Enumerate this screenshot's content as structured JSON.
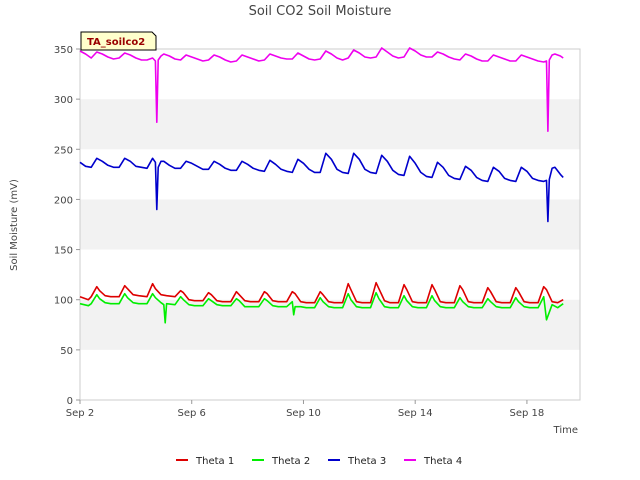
{
  "chart_data": {
    "type": "line",
    "title": "Soil CO2 Soil Moisture",
    "xlabel": "Time",
    "ylabel": "Soil Moisture (mV)",
    "annotation": "TA_soilco2",
    "ylim": [
      0,
      350
    ],
    "xlim_days": [
      2.0,
      19.9
    ],
    "ytick_values": [
      0,
      50,
      100,
      150,
      200,
      250,
      300,
      350
    ],
    "ytick_labels": [
      "0",
      "50",
      "100",
      "150",
      "200",
      "250",
      "300",
      "350"
    ],
    "xtick_values": [
      2,
      6,
      10,
      14,
      18
    ],
    "xtick_labels": [
      "Sep 2",
      "Sep 6",
      "Sep 10",
      "Sep 14",
      "Sep 18"
    ],
    "grid": "horizontal bands",
    "legend_position": "bottom-center",
    "series": [
      {
        "name": "Theta 1",
        "color": "#dd0000",
        "x": [
          2.0,
          2.3,
          2.4,
          2.6,
          2.7,
          2.9,
          3.1,
          3.4,
          3.6,
          3.7,
          3.9,
          4.1,
          4.4,
          4.6,
          4.7,
          4.9,
          5.1,
          5.4,
          5.6,
          5.7,
          5.9,
          6.1,
          6.4,
          6.6,
          6.7,
          6.9,
          7.1,
          7.4,
          7.6,
          7.7,
          7.9,
          8.1,
          8.4,
          8.6,
          8.7,
          8.9,
          9.1,
          9.4,
          9.6,
          9.7,
          9.9,
          10.1,
          10.4,
          10.6,
          10.7,
          10.9,
          11.1,
          11.4,
          11.6,
          11.7,
          11.9,
          12.1,
          12.4,
          12.6,
          12.7,
          12.9,
          13.1,
          13.4,
          13.6,
          13.7,
          13.9,
          14.1,
          14.4,
          14.6,
          14.7,
          14.9,
          15.1,
          15.4,
          15.6,
          15.7,
          15.9,
          16.1,
          16.4,
          16.6,
          16.7,
          16.9,
          17.1,
          17.4,
          17.6,
          17.7,
          17.9,
          18.1,
          18.4,
          18.6,
          18.7,
          18.9,
          19.1,
          19.3
        ],
        "values": [
          103,
          100,
          103,
          113,
          109,
          104,
          103,
          103,
          114,
          111,
          105,
          104,
          103,
          116,
          111,
          105,
          104,
          103,
          109,
          107,
          100,
          99,
          99,
          107,
          105,
          99,
          98,
          98,
          108,
          105,
          99,
          98,
          98,
          108,
          106,
          99,
          98,
          98,
          108,
          106,
          98,
          97,
          97,
          108,
          105,
          98,
          97,
          97,
          116,
          110,
          98,
          97,
          97,
          117,
          111,
          99,
          97,
          97,
          115,
          110,
          98,
          97,
          97,
          115,
          110,
          98,
          97,
          97,
          114,
          110,
          98,
          97,
          97,
          112,
          108,
          98,
          97,
          97,
          112,
          108,
          98,
          97,
          97,
          113,
          110,
          98,
          97,
          100
        ]
      },
      {
        "name": "Theta 2",
        "color": "#00ee00",
        "x": [
          2.0,
          2.3,
          2.4,
          2.6,
          2.7,
          2.9,
          3.1,
          3.4,
          3.6,
          3.7,
          3.9,
          4.1,
          4.4,
          4.6,
          4.7,
          4.9,
          5.0,
          5.05,
          5.1,
          5.4,
          5.6,
          5.7,
          5.9,
          6.1,
          6.4,
          6.6,
          6.7,
          6.9,
          7.1,
          7.4,
          7.6,
          7.7,
          7.9,
          8.1,
          8.4,
          8.6,
          8.7,
          8.9,
          9.1,
          9.4,
          9.6,
          9.65,
          9.7,
          9.9,
          10.1,
          10.4,
          10.6,
          10.7,
          10.9,
          11.1,
          11.4,
          11.6,
          11.7,
          11.9,
          12.1,
          12.4,
          12.6,
          12.7,
          12.9,
          13.1,
          13.4,
          13.6,
          13.7,
          13.9,
          14.1,
          14.4,
          14.6,
          14.7,
          14.9,
          15.1,
          15.4,
          15.6,
          15.7,
          15.9,
          16.1,
          16.4,
          16.6,
          16.7,
          16.9,
          17.1,
          17.4,
          17.6,
          17.7,
          17.9,
          18.1,
          18.4,
          18.6,
          18.7,
          18.9,
          19.1,
          19.3
        ],
        "values": [
          96,
          94,
          96,
          105,
          101,
          97,
          96,
          96,
          106,
          102,
          97,
          96,
          96,
          106,
          102,
          97,
          95,
          77,
          96,
          95,
          103,
          100,
          95,
          94,
          94,
          101,
          99,
          95,
          94,
          94,
          101,
          99,
          93,
          93,
          93,
          101,
          99,
          94,
          93,
          93,
          98,
          85,
          93,
          93,
          92,
          92,
          102,
          98,
          93,
          92,
          92,
          106,
          100,
          93,
          92,
          92,
          107,
          101,
          93,
          92,
          92,
          104,
          99,
          93,
          92,
          92,
          104,
          99,
          93,
          92,
          92,
          102,
          98,
          93,
          92,
          92,
          101,
          98,
          93,
          92,
          92,
          102,
          98,
          93,
          92,
          92,
          103,
          80,
          95,
          92,
          96
        ]
      },
      {
        "name": "Theta 3",
        "color": "#0000cc",
        "x": [
          2.0,
          2.2,
          2.4,
          2.6,
          2.8,
          3.0,
          3.2,
          3.4,
          3.6,
          3.8,
          4.0,
          4.2,
          4.4,
          4.6,
          4.7,
          4.75,
          4.8,
          4.9,
          5.0,
          5.2,
          5.4,
          5.6,
          5.8,
          6.0,
          6.2,
          6.4,
          6.6,
          6.8,
          7.0,
          7.2,
          7.4,
          7.6,
          7.8,
          8.0,
          8.2,
          8.4,
          8.6,
          8.8,
          9.0,
          9.2,
          9.4,
          9.6,
          9.8,
          10.0,
          10.2,
          10.4,
          10.6,
          10.8,
          11.0,
          11.2,
          11.4,
          11.6,
          11.8,
          12.0,
          12.2,
          12.4,
          12.6,
          12.8,
          13.0,
          13.2,
          13.4,
          13.6,
          13.8,
          14.0,
          14.2,
          14.4,
          14.6,
          14.8,
          15.0,
          15.2,
          15.4,
          15.6,
          15.8,
          16.0,
          16.2,
          16.4,
          16.6,
          16.8,
          17.0,
          17.2,
          17.4,
          17.6,
          17.8,
          18.0,
          18.2,
          18.4,
          18.6,
          18.7,
          18.75,
          18.8,
          18.9,
          19.0,
          19.2,
          19.3
        ],
        "values": [
          237,
          233,
          232,
          241,
          238,
          234,
          232,
          232,
          241,
          238,
          233,
          232,
          231,
          241,
          237,
          190,
          232,
          238,
          238,
          234,
          231,
          231,
          238,
          236,
          233,
          230,
          230,
          238,
          235,
          231,
          229,
          229,
          238,
          235,
          231,
          229,
          228,
          239,
          235,
          230,
          228,
          227,
          240,
          236,
          230,
          227,
          227,
          246,
          240,
          230,
          227,
          226,
          246,
          240,
          230,
          227,
          226,
          244,
          238,
          229,
          225,
          224,
          243,
          236,
          227,
          223,
          222,
          237,
          232,
          224,
          221,
          220,
          233,
          229,
          222,
          219,
          218,
          232,
          228,
          221,
          219,
          218,
          232,
          228,
          221,
          219,
          218,
          219,
          178,
          220,
          231,
          232,
          225,
          222
        ]
      },
      {
        "name": "Theta 4",
        "color": "#ee00ee",
        "x": [
          2.0,
          2.2,
          2.4,
          2.6,
          2.8,
          3.0,
          3.2,
          3.4,
          3.6,
          3.8,
          4.0,
          4.2,
          4.4,
          4.6,
          4.7,
          4.75,
          4.8,
          4.9,
          5.0,
          5.2,
          5.4,
          5.6,
          5.8,
          6.0,
          6.2,
          6.4,
          6.6,
          6.8,
          7.0,
          7.2,
          7.4,
          7.6,
          7.8,
          8.0,
          8.2,
          8.4,
          8.6,
          8.8,
          9.0,
          9.2,
          9.4,
          9.6,
          9.8,
          10.0,
          10.2,
          10.4,
          10.6,
          10.8,
          11.0,
          11.2,
          11.4,
          11.6,
          11.8,
          12.0,
          12.2,
          12.4,
          12.6,
          12.8,
          13.0,
          13.2,
          13.4,
          13.6,
          13.8,
          14.0,
          14.2,
          14.4,
          14.6,
          14.8,
          15.0,
          15.2,
          15.4,
          15.6,
          15.8,
          16.0,
          16.2,
          16.4,
          16.6,
          16.8,
          17.0,
          17.2,
          17.4,
          17.6,
          17.8,
          18.0,
          18.2,
          18.4,
          18.6,
          18.7,
          18.75,
          18.8,
          18.9,
          19.0,
          19.2,
          19.3
        ],
        "values": [
          348,
          345,
          341,
          347,
          345,
          342,
          340,
          341,
          346,
          344,
          341,
          339,
          339,
          341,
          338,
          277,
          339,
          343,
          345,
          343,
          340,
          339,
          344,
          342,
          340,
          338,
          339,
          344,
          342,
          339,
          337,
          338,
          344,
          342,
          340,
          338,
          339,
          345,
          343,
          341,
          340,
          340,
          346,
          343,
          340,
          339,
          340,
          348,
          345,
          341,
          339,
          341,
          349,
          346,
          342,
          341,
          342,
          351,
          347,
          343,
          341,
          342,
          351,
          348,
          344,
          342,
          342,
          347,
          345,
          342,
          340,
          339,
          345,
          343,
          340,
          338,
          338,
          344,
          342,
          340,
          338,
          338,
          344,
          342,
          340,
          338,
          337,
          338,
          268,
          339,
          344,
          345,
          343,
          341
        ]
      }
    ]
  }
}
